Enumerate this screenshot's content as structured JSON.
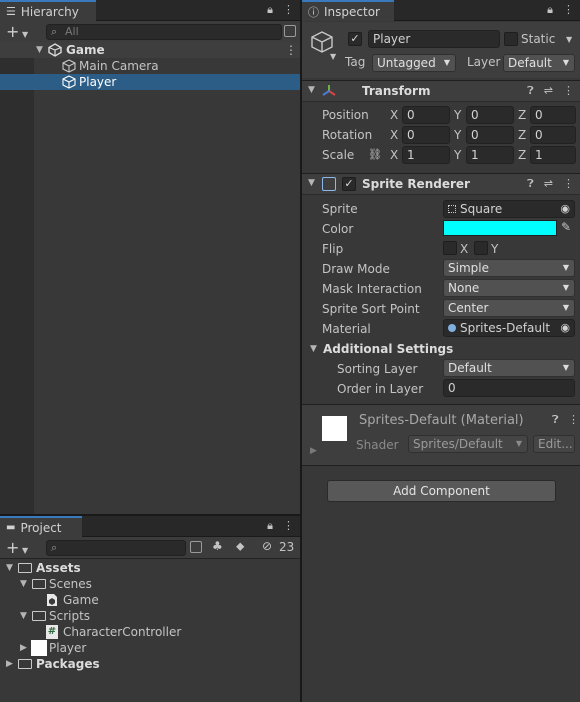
{
  "hierarchy": {
    "tab_label": "Hierarchy",
    "search_placeholder": "All",
    "scene": "Game",
    "items": [
      {
        "label": "Main Camera"
      },
      {
        "label": "Player"
      }
    ]
  },
  "inspector": {
    "tab_label": "Inspector",
    "object_name": "Player",
    "static_label": "Static",
    "tag_label": "Tag",
    "tag_value": "Untagged",
    "layer_label": "Layer",
    "layer_value": "Default",
    "transform": {
      "title": "Transform",
      "rows": [
        {
          "label": "Position",
          "x": "0",
          "y": "0",
          "z": "0"
        },
        {
          "label": "Rotation",
          "x": "0",
          "y": "0",
          "z": "0"
        },
        {
          "label": "Scale",
          "x": "1",
          "y": "1",
          "z": "1"
        }
      ],
      "axis_x": "X",
      "axis_y": "Y",
      "axis_z": "Z"
    },
    "sprite_renderer": {
      "title": "Sprite Renderer",
      "sprite_label": "Sprite",
      "sprite_value": "Square",
      "color_label": "Color",
      "color_value": "#00ffff",
      "flip_label": "Flip",
      "flip_x": "X",
      "flip_y": "Y",
      "draw_mode_label": "Draw Mode",
      "draw_mode_value": "Simple",
      "mask_label": "Mask Interaction",
      "mask_value": "None",
      "sort_point_label": "Sprite Sort Point",
      "sort_point_value": "Center",
      "material_label": "Material",
      "material_value": "Sprites-Default",
      "additional_label": "Additional Settings",
      "sorting_layer_label": "Sorting Layer",
      "sorting_layer_value": "Default",
      "order_label": "Order in Layer",
      "order_value": "0"
    },
    "material": {
      "title": "Sprites-Default (Material)",
      "shader_label": "Shader",
      "shader_value": "Sprites/Default",
      "edit_label": "Edit..."
    },
    "add_component_label": "Add Component"
  },
  "project": {
    "tab_label": "Project",
    "hidden_count": "23",
    "assets_label": "Assets",
    "tree": [
      {
        "label": "Scenes"
      },
      {
        "label": "Game"
      },
      {
        "label": "Scripts"
      },
      {
        "label": "CharacterController"
      },
      {
        "label": "Player"
      }
    ],
    "packages_label": "Packages"
  },
  "colors": {
    "selection": "#2c5d87",
    "accent": "#3a79bb",
    "sprite_color": "#00ffff"
  }
}
